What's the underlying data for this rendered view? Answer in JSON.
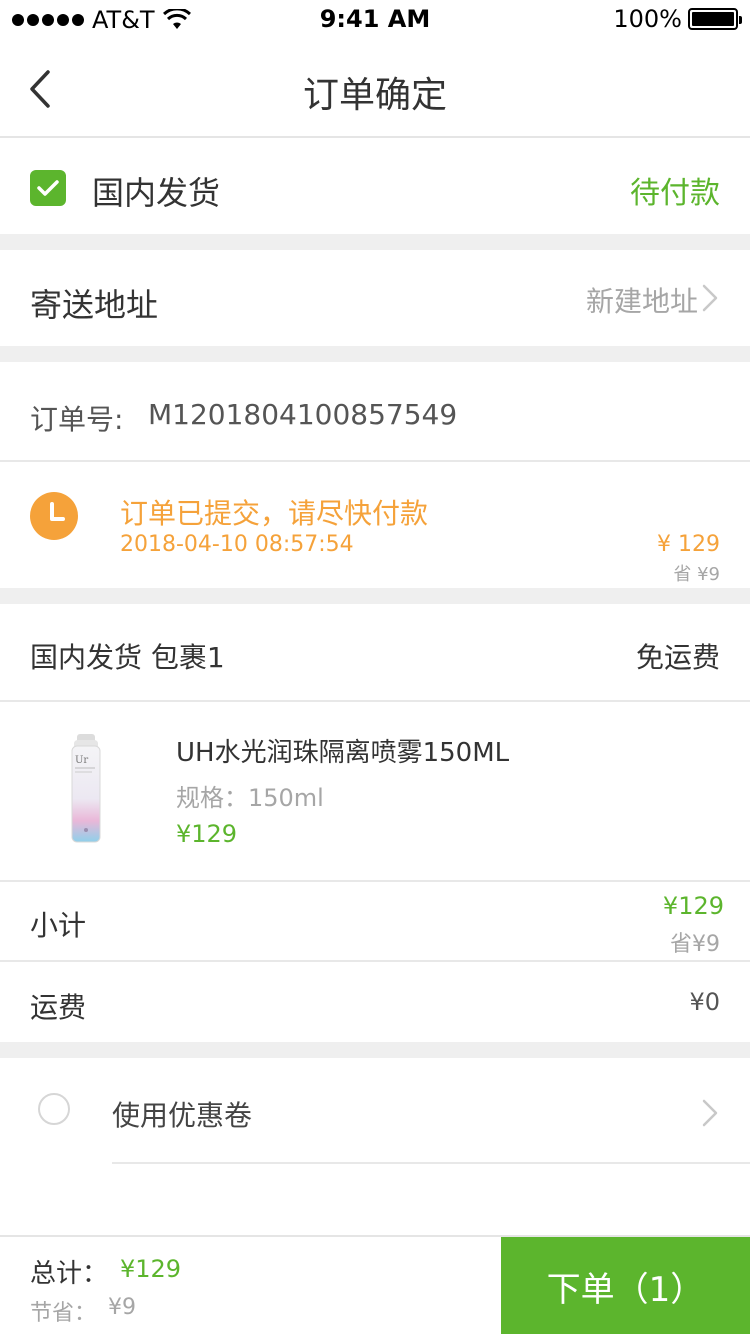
{
  "status_bar": {
    "carrier": "AT&T",
    "time": "9:41 AM",
    "battery": "100%"
  },
  "nav": {
    "title": "订单确定"
  },
  "shipping": {
    "label": "国内发货",
    "status": "待付款"
  },
  "address": {
    "label": "寄送地址",
    "action": "新建地址"
  },
  "order": {
    "number_label": "订单号:",
    "number": "M1201804100857549"
  },
  "notice": {
    "message": "订单已提交，请尽快付款",
    "datetime": "2018-04-10  08:57:54",
    "price": "¥ 129",
    "saved": "省 ¥9"
  },
  "package": {
    "label": "国内发货  包裹1",
    "shipping_fee": "免运费"
  },
  "product": {
    "name": "UH水光润珠隔离喷雾150ML",
    "spec": "规格：150ml",
    "price": "¥129",
    "image_brand": "Ur"
  },
  "subtotal": {
    "label": "小计",
    "value": "¥129",
    "saved": "省¥9"
  },
  "freight": {
    "label": "运费",
    "value": "¥0"
  },
  "coupon": {
    "label": "使用优惠卷"
  },
  "footer": {
    "total_label": "总计：",
    "total_value": "¥129",
    "saved_label": "节省：",
    "saved_value": "¥9",
    "submit_label": "下单（1）"
  },
  "colors": {
    "accent": "#5cb52d",
    "warning": "#f5a23a",
    "separator": "#efefef"
  }
}
